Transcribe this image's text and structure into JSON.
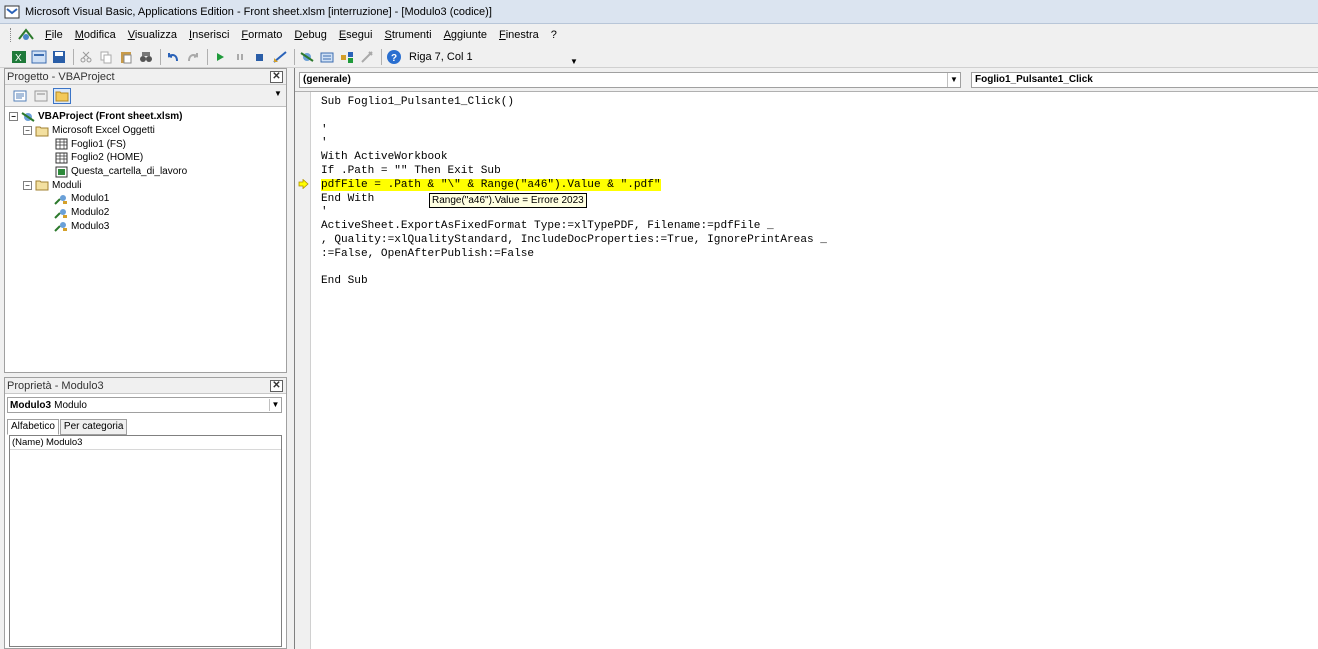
{
  "window": {
    "title": "Microsoft Visual Basic, Applications Edition - Front sheet.xlsm [interruzione] - [Modulo3 (codice)]"
  },
  "menu": {
    "items": [
      "File",
      "Modifica",
      "Visualizza",
      "Inserisci",
      "Formato",
      "Debug",
      "Esegui",
      "Strumenti",
      "Aggiunte",
      "Finestra",
      "?"
    ]
  },
  "toolbar": {
    "position_text": "Riga 7, Col 1"
  },
  "project": {
    "title": "Progetto - VBAProject",
    "tree": [
      {
        "label": "VBAProject (Front sheet.xlsm)",
        "level": 0,
        "icon": "vba-project-icon",
        "expander": "−"
      },
      {
        "label": "Microsoft Excel Oggetti",
        "level": 1,
        "icon": "folder-icon",
        "expander": "−"
      },
      {
        "label": "Foglio1 (FS)",
        "level": 2,
        "icon": "worksheet-icon",
        "expander": ""
      },
      {
        "label": "Foglio2 (HOME)",
        "level": 2,
        "icon": "worksheet-icon",
        "expander": ""
      },
      {
        "label": "Questa_cartella_di_lavoro",
        "level": 2,
        "icon": "workbook-icon",
        "expander": ""
      },
      {
        "label": "Moduli",
        "level": 1,
        "icon": "folder-icon",
        "expander": "−"
      },
      {
        "label": "Modulo1",
        "level": 2,
        "icon": "module-icon",
        "expander": ""
      },
      {
        "label": "Modulo2",
        "level": 2,
        "icon": "module-icon",
        "expander": ""
      },
      {
        "label": "Modulo3",
        "level": 2,
        "icon": "module-icon",
        "expander": ""
      }
    ]
  },
  "properties": {
    "title": "Proprietà - Modulo3",
    "object_name": "Modulo3",
    "object_type": "Modulo",
    "tabs": [
      "Alfabetico",
      "Per categoria"
    ],
    "rows": [
      {
        "name": "(Name)",
        "value": "Modulo3"
      }
    ]
  },
  "code": {
    "object_combo": "(generale)",
    "procedure_combo": "Foglio1_Pulsante1_Click",
    "tooltip": "Range(\"a46\").Value = Errore 2023",
    "lines": [
      "Sub Foglio1_Pulsante1_Click()",
      "",
      "'",
      "'",
      "With ActiveWorkbook",
      "If .Path = \"\" Then Exit Sub",
      "pdfFile = .Path & \"\\\" & Range(\"a46\").Value & \".pdf\"",
      "End With",
      "'",
      "ActiveSheet.ExportAsFixedFormat Type:=xlTypePDF, Filename:=pdfFile _",
      ", Quality:=xlQualityStandard, IncludeDocProperties:=True, IgnorePrintAreas _",
      ":=False, OpenAfterPublish:=False",
      "",
      "End Sub"
    ],
    "highlight_line": 6,
    "highlight_color": "#ffff00"
  }
}
